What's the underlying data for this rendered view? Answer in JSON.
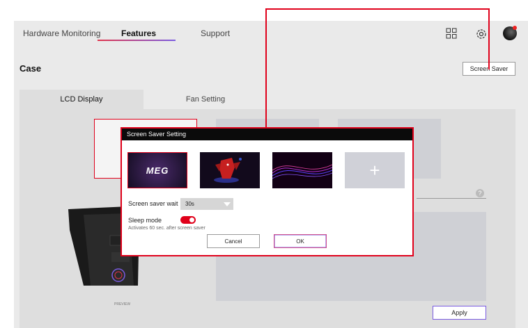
{
  "nav": {
    "tabs": [
      {
        "label": "Hardware Monitoring",
        "active": false
      },
      {
        "label": "Features",
        "active": true
      },
      {
        "label": "Support",
        "active": false
      }
    ],
    "icons": [
      "apps-grid-icon",
      "settings-gear-icon",
      "user-avatar-icon"
    ]
  },
  "case": {
    "title": "Case",
    "screen_saver_button": "Screen Saver",
    "sub_tabs": [
      {
        "label": "LCD Display",
        "active": true
      },
      {
        "label": "Fan Setting",
        "active": false
      }
    ],
    "preview_label": "PREVIEW",
    "apply_button": "Apply",
    "help_icon": "question-icon"
  },
  "modal": {
    "title": "Screen Saver Setting",
    "thumbnails": [
      {
        "name": "meg-logo",
        "text": "MEG",
        "selected": true
      },
      {
        "name": "dragon-mascot",
        "selected": false
      },
      {
        "name": "purple-waves",
        "selected": false
      },
      {
        "name": "add-new",
        "icon": "plus-icon",
        "selected": false
      }
    ],
    "wait_label": "Screen saver wait",
    "wait_value": "30s",
    "sleep_label": "Sleep mode",
    "sleep_on": true,
    "sleep_note": "Activates 60 sec. after screen saver",
    "cancel_label": "Cancel",
    "ok_label": "OK"
  },
  "colors": {
    "accent": "#e0001a",
    "ok_border_start": "#e0344c",
    "ok_border_end": "#7a5be0"
  }
}
